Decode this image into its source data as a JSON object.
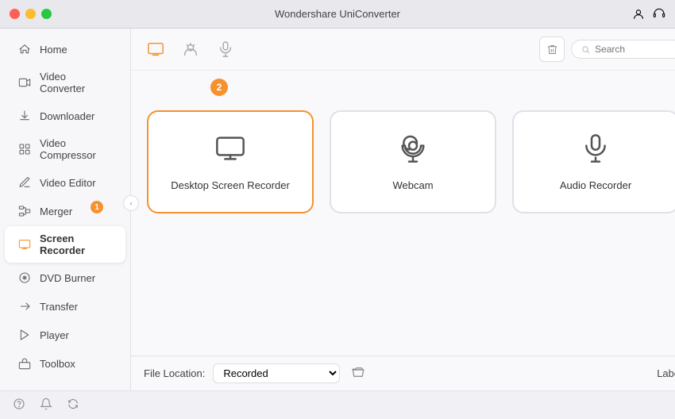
{
  "titlebar": {
    "title": "Wondershare UniConverter",
    "buttons": [
      "close",
      "minimize",
      "maximize"
    ]
  },
  "sidebar": {
    "items": [
      {
        "id": "home",
        "label": "Home",
        "icon": "house",
        "active": false,
        "badge": null
      },
      {
        "id": "video-converter",
        "label": "Video Converter",
        "icon": "video",
        "active": false,
        "badge": null
      },
      {
        "id": "downloader",
        "label": "Downloader",
        "icon": "download",
        "active": false,
        "badge": null
      },
      {
        "id": "video-compressor",
        "label": "Video Compressor",
        "icon": "compress",
        "active": false,
        "badge": null
      },
      {
        "id": "video-editor",
        "label": "Video Editor",
        "icon": "edit",
        "active": false,
        "badge": null
      },
      {
        "id": "merger",
        "label": "Merger",
        "icon": "merge",
        "active": false,
        "badge": "1"
      },
      {
        "id": "screen-recorder",
        "label": "Screen Recorder",
        "icon": "screen",
        "active": true,
        "badge": null
      },
      {
        "id": "dvd-burner",
        "label": "DVD Burner",
        "icon": "dvd",
        "active": false,
        "badge": null
      },
      {
        "id": "transfer",
        "label": "Transfer",
        "icon": "transfer",
        "active": false,
        "badge": null
      },
      {
        "id": "player",
        "label": "Player",
        "icon": "play",
        "active": false,
        "badge": null
      },
      {
        "id": "toolbox",
        "label": "Toolbox",
        "icon": "toolbox",
        "active": false,
        "badge": null
      }
    ]
  },
  "toolbar": {
    "tabs": [
      {
        "id": "screen",
        "active": true
      },
      {
        "id": "webcam",
        "active": false
      },
      {
        "id": "audio",
        "active": false
      }
    ],
    "search_placeholder": "Search",
    "step_badge": "2"
  },
  "recorders": {
    "step_badge": "2",
    "cards": [
      {
        "id": "desktop",
        "label": "Desktop Screen Recorder",
        "selected": true
      },
      {
        "id": "webcam",
        "label": "Webcam",
        "selected": false
      },
      {
        "id": "audio",
        "label": "Audio Recorder",
        "selected": false
      }
    ]
  },
  "bottom_bar": {
    "file_location_label": "File Location:",
    "file_location_value": "Recorded",
    "label_btn": "Label"
  },
  "statusbar": {
    "icons": [
      "help",
      "bell",
      "sync"
    ]
  },
  "colors": {
    "accent": "#f5922e"
  }
}
